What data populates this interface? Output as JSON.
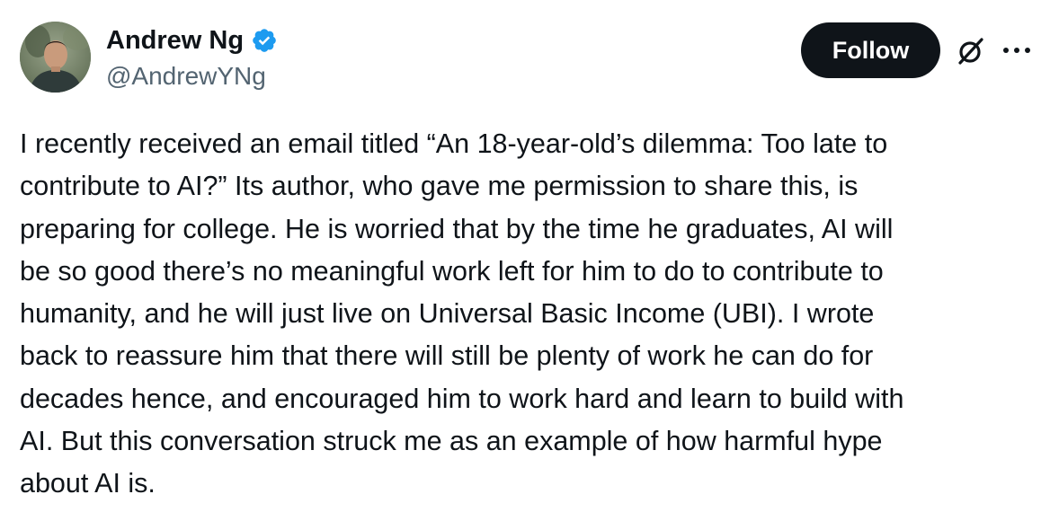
{
  "author": {
    "display_name": "Andrew Ng",
    "handle": "@AndrewYNg",
    "verified": true,
    "verified_color": "#1d9bf0"
  },
  "actions": {
    "follow_label": "Follow",
    "grok_icon": "grok-icon",
    "more_icon": "more-icon"
  },
  "tweet": {
    "lines": [
      "I recently received an email titled “An 18-year-old’s dilemma: Too late to",
      "contribute to AI?” Its author, who gave me permission to share this, is",
      "preparing for college. He is worried that by the time he graduates, AI will",
      "be so good there’s no meaningful work left for him to do to contribute to",
      "humanity, and he will just live on Universal Basic Income (UBI). I wrote",
      "back to reassure him that there will still be plenty of work he can do for",
      "decades hence, and encouraged him to work hard and learn to build with",
      "AI. But this conversation struck me as an example of how harmful hype",
      "about AI is."
    ]
  },
  "colors": {
    "text": "#0f1419",
    "secondary_text": "#536471",
    "follow_bg": "#0f1419",
    "follow_text": "#ffffff"
  }
}
